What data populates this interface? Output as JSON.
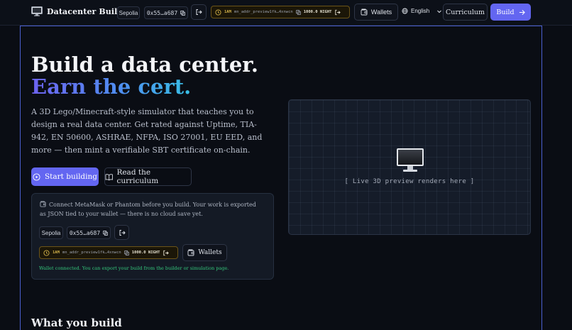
{
  "nav": {
    "brand": "Datacenter Builder",
    "network": "Sepolia",
    "wallet_address": "0x55…a687",
    "midnight_tag": "1AM",
    "midnight_address": "mn_addr_preview1fk…4xnwcn",
    "midnight_balance": "1000.0 NIGHT",
    "wallets_label": "Wallets",
    "language": "English",
    "curriculum_label": "Curriculum",
    "build_label": "Build"
  },
  "hero": {
    "title": "Build a data center.",
    "subtitle": "Earn the cert.",
    "description": "A 3D Lego/Minecraft-style simulator that teaches you to design a real data center. Get rated against Uptime, TIA-942, EN 50600, ASHRAE, NFPA, ISO 27001, EU EED, and more — then mint a verifiable SBT certificate on-chain.",
    "start_label": "Start building",
    "curriculum_label": "Read the curriculum"
  },
  "wallet_card": {
    "message": "Connect MetaMask or Phantom before you build. Your work is exported as JSON tied to your wallet — there is no cloud save yet.",
    "network": "Sepolia",
    "wallet_address": "0x55…a687",
    "midnight_tag": "1AM",
    "midnight_address": "mn_addr_preview1fk…4xnwcn",
    "midnight_balance": "1000.0 NIGHT",
    "wallets_label": "Wallets",
    "status": "Wallet connected. You can export your build from the builder or simulation page."
  },
  "preview": {
    "caption": "[ Live 3D preview renders here ]"
  },
  "sections": {
    "what_you_build": "What you build"
  },
  "colors": {
    "accent": "#6366f1",
    "success": "#34c77b",
    "midnight_gold": "#d4b34a"
  }
}
